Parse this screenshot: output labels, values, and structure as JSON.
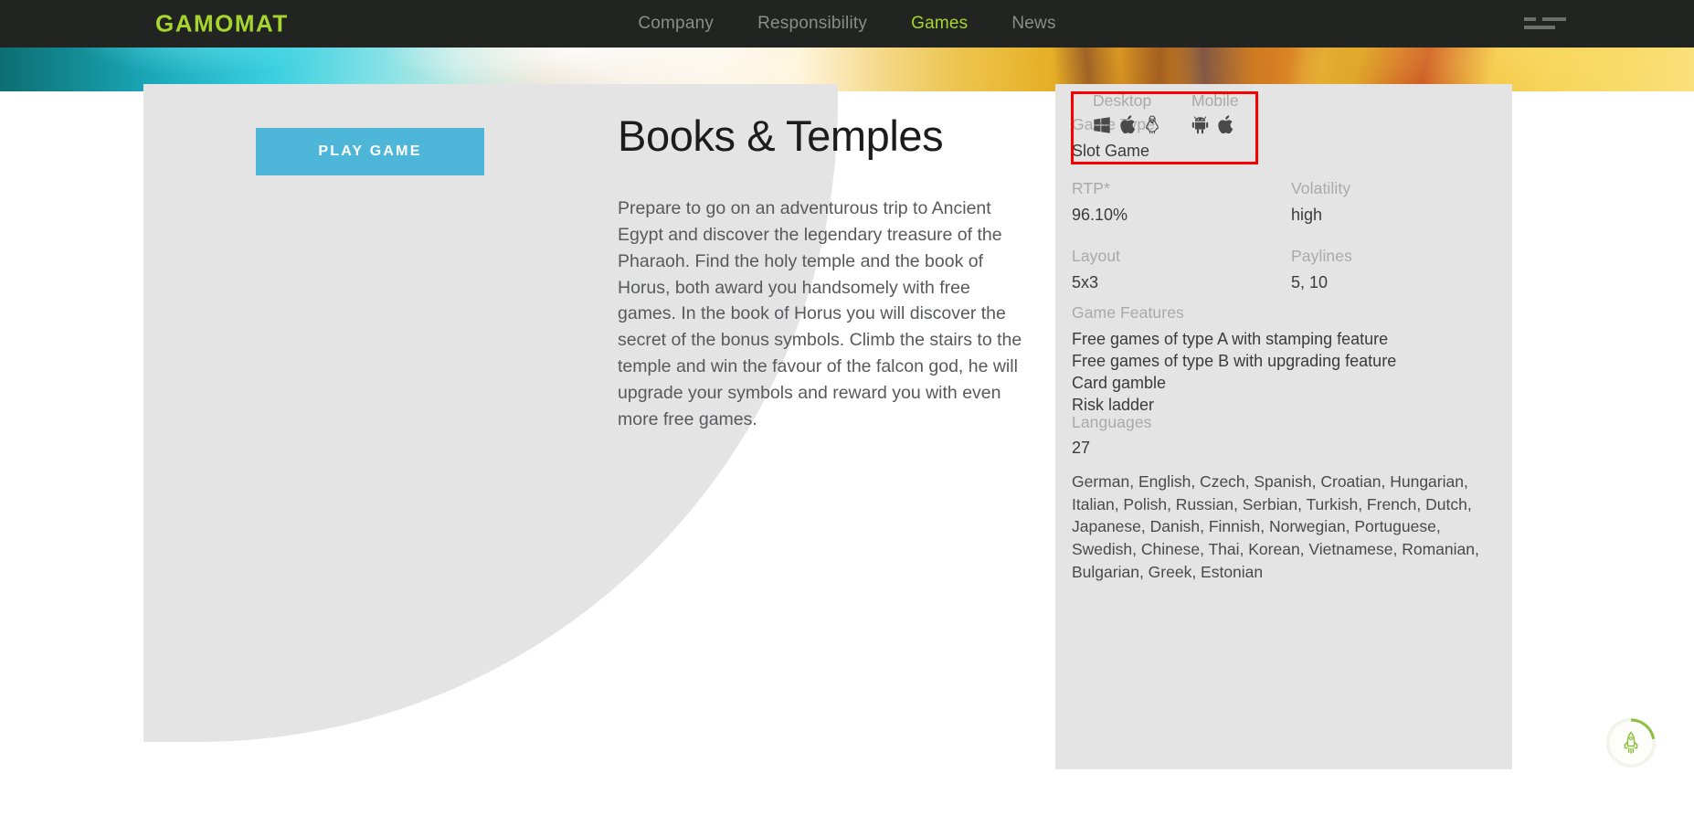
{
  "colors": {
    "brand_green": "#a7d52f",
    "navbar_bg": "#222421",
    "panel_grey": "#e4e4e4",
    "play_button_blue": "#4db6d9",
    "highlight_red": "#f80000",
    "body_text": "#58595b",
    "label_grey": "#a9a9a9"
  },
  "header": {
    "logo": "GAMOMAT",
    "nav": [
      {
        "label": "Company",
        "active": false
      },
      {
        "label": "Responsibility",
        "active": false
      },
      {
        "label": "Games",
        "active": true
      },
      {
        "label": "News",
        "active": false
      }
    ],
    "menu_icon": "hamburger-icon"
  },
  "left": {
    "play_button": "PLAY GAME"
  },
  "main": {
    "title": "Books & Temples",
    "description": "Prepare to go on an adventurous trip to Ancient Egypt and discover the legendary treasure of the Pharaoh. Find the holy temple and the book of Horus, both award you handsomely with free games. In the book of Horus you will discover the secret of the bonus symbols. Climb the stairs to the temple and win the favour of the falcon god, he will upgrade your symbols and reward you with even more free games."
  },
  "info": {
    "game_type": {
      "label": "Game Type",
      "value": "Slot Game"
    },
    "rtp": {
      "label": "RTP*",
      "value": "96.10%"
    },
    "volatility": {
      "label": "Volatility",
      "value": "high"
    },
    "layout": {
      "label": "Layout",
      "value": "5x3"
    },
    "paylines": {
      "label": "Paylines",
      "value": "5, 10"
    },
    "game_features": {
      "label": "Game Features",
      "items": [
        "Free games of type A with stamping feature",
        "Free games of type B with upgrading feature",
        "Card gamble",
        "Risk ladder"
      ]
    },
    "languages": {
      "label": "Languages",
      "count": "27",
      "list": "German, English, Czech, Spanish, Croatian, Hungarian, Italian, Polish, Russian, Serbian, Turkish, French, Dutch, Japanese, Danish, Finnish, Norwegian, Portuguese, Swedish, Chinese, Thai, Korean, Vietnamese, Romanian, Bulgarian, Greek, Estonian"
    },
    "platforms": {
      "desktop": {
        "label": "Desktop",
        "icons": [
          "windows-icon",
          "apple-icon",
          "linux-icon"
        ]
      },
      "mobile": {
        "label": "Mobile",
        "icons": [
          "android-icon",
          "apple-icon"
        ]
      },
      "highlighted": true
    }
  },
  "floating_widget": {
    "icon": "rocket-icon",
    "progress_percent": 22
  }
}
